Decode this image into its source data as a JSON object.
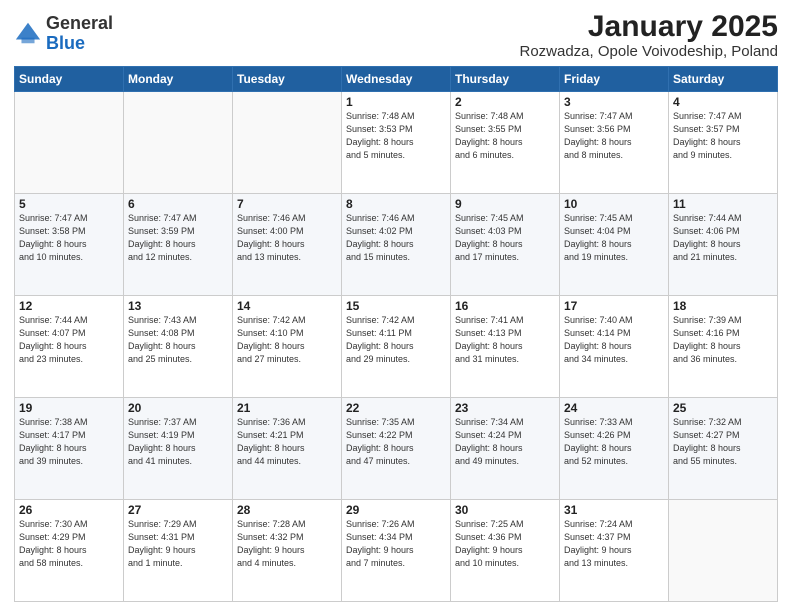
{
  "header": {
    "logo_general": "General",
    "logo_blue": "Blue",
    "title": "January 2025",
    "subtitle": "Rozwadza, Opole Voivodeship, Poland"
  },
  "days_of_week": [
    "Sunday",
    "Monday",
    "Tuesday",
    "Wednesday",
    "Thursday",
    "Friday",
    "Saturday"
  ],
  "weeks": [
    [
      {
        "day": "",
        "info": ""
      },
      {
        "day": "",
        "info": ""
      },
      {
        "day": "",
        "info": ""
      },
      {
        "day": "1",
        "info": "Sunrise: 7:48 AM\nSunset: 3:53 PM\nDaylight: 8 hours\nand 5 minutes."
      },
      {
        "day": "2",
        "info": "Sunrise: 7:48 AM\nSunset: 3:55 PM\nDaylight: 8 hours\nand 6 minutes."
      },
      {
        "day": "3",
        "info": "Sunrise: 7:47 AM\nSunset: 3:56 PM\nDaylight: 8 hours\nand 8 minutes."
      },
      {
        "day": "4",
        "info": "Sunrise: 7:47 AM\nSunset: 3:57 PM\nDaylight: 8 hours\nand 9 minutes."
      }
    ],
    [
      {
        "day": "5",
        "info": "Sunrise: 7:47 AM\nSunset: 3:58 PM\nDaylight: 8 hours\nand 10 minutes."
      },
      {
        "day": "6",
        "info": "Sunrise: 7:47 AM\nSunset: 3:59 PM\nDaylight: 8 hours\nand 12 minutes."
      },
      {
        "day": "7",
        "info": "Sunrise: 7:46 AM\nSunset: 4:00 PM\nDaylight: 8 hours\nand 13 minutes."
      },
      {
        "day": "8",
        "info": "Sunrise: 7:46 AM\nSunset: 4:02 PM\nDaylight: 8 hours\nand 15 minutes."
      },
      {
        "day": "9",
        "info": "Sunrise: 7:45 AM\nSunset: 4:03 PM\nDaylight: 8 hours\nand 17 minutes."
      },
      {
        "day": "10",
        "info": "Sunrise: 7:45 AM\nSunset: 4:04 PM\nDaylight: 8 hours\nand 19 minutes."
      },
      {
        "day": "11",
        "info": "Sunrise: 7:44 AM\nSunset: 4:06 PM\nDaylight: 8 hours\nand 21 minutes."
      }
    ],
    [
      {
        "day": "12",
        "info": "Sunrise: 7:44 AM\nSunset: 4:07 PM\nDaylight: 8 hours\nand 23 minutes."
      },
      {
        "day": "13",
        "info": "Sunrise: 7:43 AM\nSunset: 4:08 PM\nDaylight: 8 hours\nand 25 minutes."
      },
      {
        "day": "14",
        "info": "Sunrise: 7:42 AM\nSunset: 4:10 PM\nDaylight: 8 hours\nand 27 minutes."
      },
      {
        "day": "15",
        "info": "Sunrise: 7:42 AM\nSunset: 4:11 PM\nDaylight: 8 hours\nand 29 minutes."
      },
      {
        "day": "16",
        "info": "Sunrise: 7:41 AM\nSunset: 4:13 PM\nDaylight: 8 hours\nand 31 minutes."
      },
      {
        "day": "17",
        "info": "Sunrise: 7:40 AM\nSunset: 4:14 PM\nDaylight: 8 hours\nand 34 minutes."
      },
      {
        "day": "18",
        "info": "Sunrise: 7:39 AM\nSunset: 4:16 PM\nDaylight: 8 hours\nand 36 minutes."
      }
    ],
    [
      {
        "day": "19",
        "info": "Sunrise: 7:38 AM\nSunset: 4:17 PM\nDaylight: 8 hours\nand 39 minutes."
      },
      {
        "day": "20",
        "info": "Sunrise: 7:37 AM\nSunset: 4:19 PM\nDaylight: 8 hours\nand 41 minutes."
      },
      {
        "day": "21",
        "info": "Sunrise: 7:36 AM\nSunset: 4:21 PM\nDaylight: 8 hours\nand 44 minutes."
      },
      {
        "day": "22",
        "info": "Sunrise: 7:35 AM\nSunset: 4:22 PM\nDaylight: 8 hours\nand 47 minutes."
      },
      {
        "day": "23",
        "info": "Sunrise: 7:34 AM\nSunset: 4:24 PM\nDaylight: 8 hours\nand 49 minutes."
      },
      {
        "day": "24",
        "info": "Sunrise: 7:33 AM\nSunset: 4:26 PM\nDaylight: 8 hours\nand 52 minutes."
      },
      {
        "day": "25",
        "info": "Sunrise: 7:32 AM\nSunset: 4:27 PM\nDaylight: 8 hours\nand 55 minutes."
      }
    ],
    [
      {
        "day": "26",
        "info": "Sunrise: 7:30 AM\nSunset: 4:29 PM\nDaylight: 8 hours\nand 58 minutes."
      },
      {
        "day": "27",
        "info": "Sunrise: 7:29 AM\nSunset: 4:31 PM\nDaylight: 9 hours\nand 1 minute."
      },
      {
        "day": "28",
        "info": "Sunrise: 7:28 AM\nSunset: 4:32 PM\nDaylight: 9 hours\nand 4 minutes."
      },
      {
        "day": "29",
        "info": "Sunrise: 7:26 AM\nSunset: 4:34 PM\nDaylight: 9 hours\nand 7 minutes."
      },
      {
        "day": "30",
        "info": "Sunrise: 7:25 AM\nSunset: 4:36 PM\nDaylight: 9 hours\nand 10 minutes."
      },
      {
        "day": "31",
        "info": "Sunrise: 7:24 AM\nSunset: 4:37 PM\nDaylight: 9 hours\nand 13 minutes."
      },
      {
        "day": "",
        "info": ""
      }
    ]
  ]
}
